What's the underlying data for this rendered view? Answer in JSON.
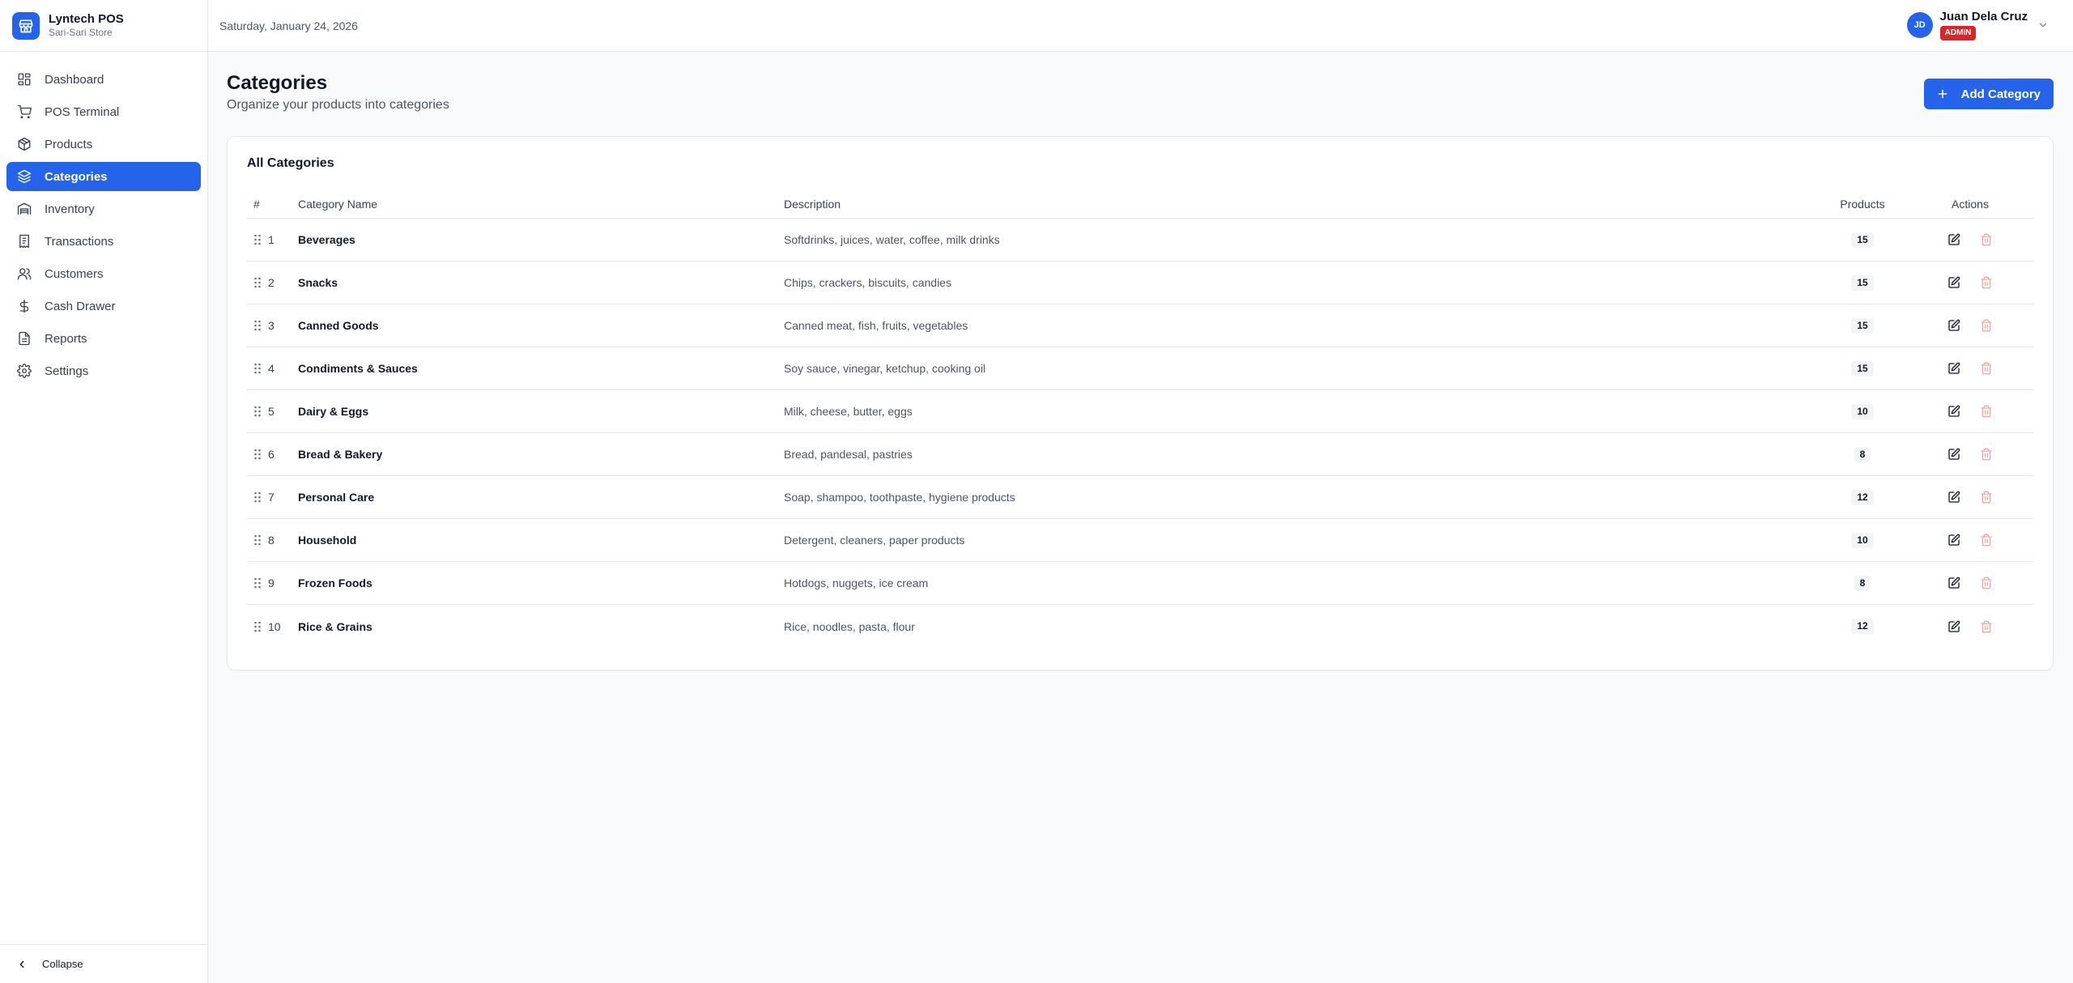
{
  "brand": {
    "name": "Lyntech POS",
    "subtitle": "Sari-Sari Store"
  },
  "header": {
    "date": "Saturday, January 24, 2026",
    "user": {
      "initials": "JD",
      "name": "Juan Dela Cruz",
      "role": "ADMIN"
    }
  },
  "sidebar": {
    "items": [
      {
        "label": "Dashboard",
        "icon": "dashboard-icon",
        "active": false
      },
      {
        "label": "POS Terminal",
        "icon": "cart-icon",
        "active": false
      },
      {
        "label": "Products",
        "icon": "package-icon",
        "active": false
      },
      {
        "label": "Categories",
        "icon": "layers-icon",
        "active": true
      },
      {
        "label": "Inventory",
        "icon": "warehouse-icon",
        "active": false
      },
      {
        "label": "Transactions",
        "icon": "receipt-icon",
        "active": false
      },
      {
        "label": "Customers",
        "icon": "users-icon",
        "active": false
      },
      {
        "label": "Cash Drawer",
        "icon": "dollar-icon",
        "active": false
      },
      {
        "label": "Reports",
        "icon": "file-icon",
        "active": false
      },
      {
        "label": "Settings",
        "icon": "gear-icon",
        "active": false
      }
    ],
    "collapse_label": "Collapse"
  },
  "page": {
    "title": "Categories",
    "subtitle": "Organize your products into categories",
    "add_button": "Add Category"
  },
  "table": {
    "title": "All Categories",
    "columns": {
      "num": "#",
      "name": "Category Name",
      "description": "Description",
      "products": "Products",
      "actions": "Actions"
    },
    "rows": [
      {
        "num": "1",
        "name": "Beverages",
        "description": "Softdrinks, juices, water, coffee, milk drinks",
        "products": "15"
      },
      {
        "num": "2",
        "name": "Snacks",
        "description": "Chips, crackers, biscuits, candies",
        "products": "15"
      },
      {
        "num": "3",
        "name": "Canned Goods",
        "description": "Canned meat, fish, fruits, vegetables",
        "products": "15"
      },
      {
        "num": "4",
        "name": "Condiments & Sauces",
        "description": "Soy sauce, vinegar, ketchup, cooking oil",
        "products": "15"
      },
      {
        "num": "5",
        "name": "Dairy & Eggs",
        "description": "Milk, cheese, butter, eggs",
        "products": "10"
      },
      {
        "num": "6",
        "name": "Bread & Bakery",
        "description": "Bread, pandesal, pastries",
        "products": "8"
      },
      {
        "num": "7",
        "name": "Personal Care",
        "description": "Soap, shampoo, toothpaste, hygiene products",
        "products": "12"
      },
      {
        "num": "8",
        "name": "Household",
        "description": "Detergent, cleaners, paper products",
        "products": "10"
      },
      {
        "num": "9",
        "name": "Frozen Foods",
        "description": "Hotdogs, nuggets, ice cream",
        "products": "8"
      },
      {
        "num": "10",
        "name": "Rice & Grains",
        "description": "Rice, noodles, pasta, flour",
        "products": "12"
      }
    ]
  },
  "colors": {
    "primary": "#2563eb",
    "danger": "#dc2626",
    "delete_icon": "#f8a5a5"
  }
}
